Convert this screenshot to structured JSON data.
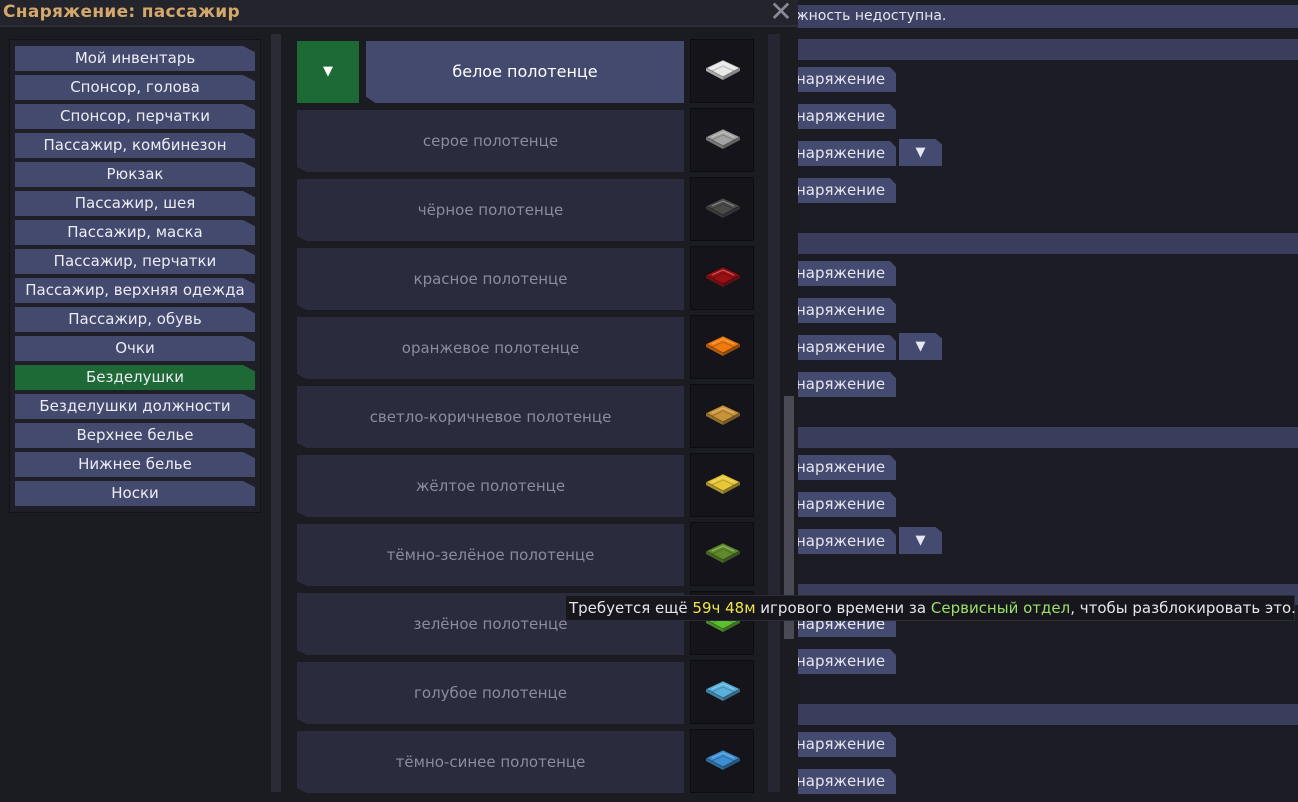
{
  "window": {
    "title": "Снаряжение: пассажир",
    "close_glyph": "✕"
  },
  "background": {
    "status_text": "жность недоступна.",
    "button_label": "наряжение",
    "dropdown_glyph": "▼"
  },
  "categories": [
    {
      "label": "Мой инвентарь",
      "active": false
    },
    {
      "label": "Спонсор, голова",
      "active": false
    },
    {
      "label": "Спонсор, перчатки",
      "active": false
    },
    {
      "label": "Пассажир, комбинезон",
      "active": false
    },
    {
      "label": "Рюкзак",
      "active": false
    },
    {
      "label": "Пассажир, шея",
      "active": false
    },
    {
      "label": "Пассажир, маска",
      "active": false
    },
    {
      "label": "Пассажир, перчатки",
      "active": false
    },
    {
      "label": "Пассажир, верхняя одежда",
      "active": false
    },
    {
      "label": "Пассажир, обувь",
      "active": false
    },
    {
      "label": "Очки",
      "active": false
    },
    {
      "label": "Безделушки",
      "active": true
    },
    {
      "label": "Безделушки должности",
      "active": false
    },
    {
      "label": "Верхнее белье",
      "active": false
    },
    {
      "label": "Нижнее белье",
      "active": false
    },
    {
      "label": "Носки",
      "active": false
    }
  ],
  "items": [
    {
      "name": "белое полотенце",
      "selected": true,
      "color": "#e8e8e8",
      "icon": "towel-white-icon"
    },
    {
      "name": "серое полотенце",
      "selected": false,
      "color": "#a3a3a3",
      "icon": "towel-gray-icon"
    },
    {
      "name": "чёрное полотенце",
      "selected": false,
      "color": "#4a4a4a",
      "icon": "towel-black-icon"
    },
    {
      "name": "красное полотенце",
      "selected": false,
      "color": "#9a0f12",
      "icon": "towel-red-icon"
    },
    {
      "name": "оранжевое полотенце",
      "selected": false,
      "color": "#f07a0e",
      "icon": "towel-orange-icon"
    },
    {
      "name": "светло-коричневое полотенце",
      "selected": false,
      "color": "#c8943a",
      "icon": "towel-tan-icon"
    },
    {
      "name": "жёлтое полотенце",
      "selected": false,
      "color": "#e8c83a",
      "icon": "towel-yellow-icon"
    },
    {
      "name": "тёмно-зелёное полотенце",
      "selected": false,
      "color": "#5e8a2c",
      "icon": "towel-darkgreen-icon"
    },
    {
      "name": "зелёное полотенце",
      "selected": false,
      "color": "#5ec02e",
      "icon": "towel-green-icon"
    },
    {
      "name": "голубое полотенце",
      "selected": false,
      "color": "#5ab0dc",
      "icon": "towel-lightblue-icon"
    },
    {
      "name": "тёмно-синее полотенце",
      "selected": false,
      "color": "#3c8ed0",
      "icon": "towel-darkblue-icon"
    }
  ],
  "selected_dropdown_glyph": "▼",
  "tooltip": {
    "prefix": "Требуется ещё ",
    "time": "59ч 48м",
    "middle": " игрового времени за ",
    "department": "Сервисный отдел",
    "suffix": ", чтобы разблокировать это."
  },
  "colors": {
    "accent_green": "#1e6a37",
    "button_blue": "#434a6d",
    "title_gold": "#d3a86a",
    "time_yellow": "#f0e64a",
    "dept_green": "#9be06a"
  }
}
